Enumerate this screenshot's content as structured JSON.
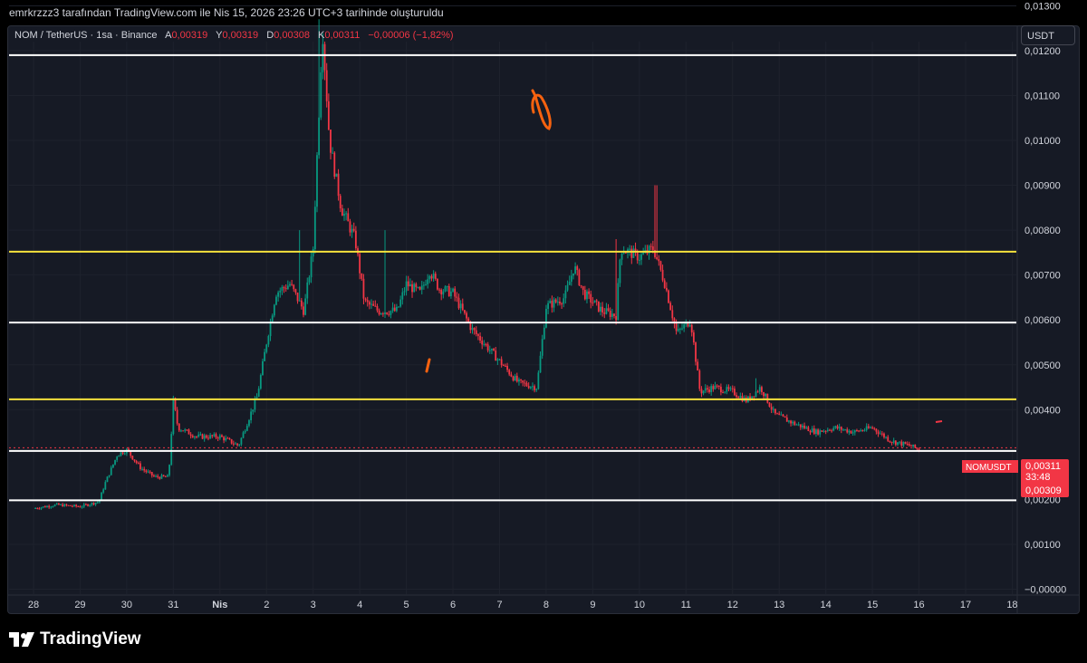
{
  "header": {
    "publish_line": "emrkrzzz3 tarafından TradingView.com ile Nis 15, 2026 23:26 UTC+3 tarihinde oluşturuldu"
  },
  "legend": {
    "symbol": "NOM / TetherUS · 1sa · Binance",
    "o_label": "A",
    "o_value": "0,00319",
    "h_label": "Y",
    "h_value": "0,00319",
    "l_label": "D",
    "l_value": "0,00308",
    "c_label": "K",
    "c_value": "0,00311",
    "change": "−0,00006 (−1,82%)"
  },
  "currency_button": "USDT",
  "price_tag": {
    "symbol": "NOMUSDT",
    "last": "0,00311",
    "countdown": "33:48",
    "bid": "0,00309"
  },
  "footer": {
    "brand": "TradingView"
  },
  "colors": {
    "up": "#089981",
    "down": "#f23645",
    "white_line": "#ffffff",
    "yellow_line": "#f5e23c",
    "annotation": "#f7620f",
    "background": "#161a25"
  },
  "chart_data": {
    "type": "candlestick",
    "ylim": [
      -0.0002,
      0.0145
    ],
    "y_ticks": [
      {
        "value": 0.013,
        "label": "0,01300"
      },
      {
        "value": 0.012,
        "label": "0,01200"
      },
      {
        "value": 0.011,
        "label": "0,01100"
      },
      {
        "value": 0.01,
        "label": "0,01000"
      },
      {
        "value": 0.009,
        "label": "0,00900"
      },
      {
        "value": 0.008,
        "label": "0,00800"
      },
      {
        "value": 0.007,
        "label": "0,00700"
      },
      {
        "value": 0.006,
        "label": "0,00600"
      },
      {
        "value": 0.005,
        "label": "0,00500"
      },
      {
        "value": 0.004,
        "label": "0,00400"
      },
      {
        "value": 0.002,
        "label": "0,00200"
      },
      {
        "value": 0.001,
        "label": "0,00100"
      },
      {
        "value": 0.0,
        "label": "−0,00000"
      }
    ],
    "x_labels": [
      "28",
      "29",
      "30",
      "31",
      "Nis",
      "2",
      "3",
      "4",
      "5",
      "6",
      "7",
      "8",
      "9",
      "10",
      "11",
      "12",
      "13",
      "14",
      "15",
      "16",
      "17",
      "18"
    ],
    "horizontal_levels": [
      {
        "value": 0.0119,
        "color": "white"
      },
      {
        "value": 0.00752,
        "color": "yellow"
      },
      {
        "value": 0.00594,
        "color": "white"
      },
      {
        "value": 0.00423,
        "color": "yellow"
      },
      {
        "value": 0.00308,
        "color": "white"
      },
      {
        "value": 0.00198,
        "color": "white"
      }
    ],
    "last_price": 0.00311,
    "price_path": [
      [
        0,
        0.0018
      ],
      [
        0.5,
        0.00188
      ],
      [
        1.0,
        0.00184
      ],
      [
        1.4,
        0.00195
      ],
      [
        1.55,
        0.0024
      ],
      [
        1.8,
        0.003
      ],
      [
        2.0,
        0.0031
      ],
      [
        2.3,
        0.0027
      ],
      [
        2.6,
        0.0025
      ],
      [
        2.9,
        0.0025
      ],
      [
        3.0,
        0.0042
      ],
      [
        3.1,
        0.0036
      ],
      [
        3.5,
        0.0034
      ],
      [
        4.0,
        0.0034
      ],
      [
        4.4,
        0.0032
      ],
      [
        4.8,
        0.0043
      ],
      [
        5.0,
        0.0055
      ],
      [
        5.2,
        0.0066
      ],
      [
        5.5,
        0.0068
      ],
      [
        5.8,
        0.0062
      ],
      [
        6.0,
        0.0076
      ],
      [
        6.2,
        0.0125
      ],
      [
        6.35,
        0.01
      ],
      [
        6.6,
        0.0085
      ],
      [
        6.9,
        0.0078
      ],
      [
        7.1,
        0.0064
      ],
      [
        7.4,
        0.0062
      ],
      [
        7.8,
        0.0062
      ],
      [
        8.0,
        0.0068
      ],
      [
        8.3,
        0.0066
      ],
      [
        8.5,
        0.0071
      ],
      [
        8.7,
        0.0067
      ],
      [
        9.0,
        0.0066
      ],
      [
        9.4,
        0.0058
      ],
      [
        9.9,
        0.0052
      ],
      [
        10.4,
        0.0046
      ],
      [
        10.8,
        0.0045
      ],
      [
        11.0,
        0.0063
      ],
      [
        11.4,
        0.0065
      ],
      [
        11.6,
        0.0072
      ],
      [
        11.8,
        0.0066
      ],
      [
        12.2,
        0.0062
      ],
      [
        12.5,
        0.0061
      ],
      [
        12.6,
        0.0076
      ],
      [
        13.0,
        0.0074
      ],
      [
        13.3,
        0.0076
      ],
      [
        13.55,
        0.0068
      ],
      [
        13.8,
        0.0057
      ],
      [
        14.1,
        0.006
      ],
      [
        14.3,
        0.0044
      ],
      [
        14.6,
        0.0045
      ],
      [
        15.0,
        0.0044
      ],
      [
        15.3,
        0.0042
      ],
      [
        15.6,
        0.0045
      ],
      [
        15.9,
        0.0039
      ],
      [
        16.3,
        0.0037
      ],
      [
        16.8,
        0.0035
      ],
      [
        17.2,
        0.0036
      ],
      [
        17.6,
        0.0035
      ],
      [
        18.0,
        0.0036
      ],
      [
        18.4,
        0.0033
      ],
      [
        18.8,
        0.0032
      ],
      [
        19.0,
        0.00311
      ]
    ],
    "spikes": [
      {
        "x": 6.12,
        "high": 0.0127
      },
      {
        "x": 6.3,
        "high": 0.0106
      },
      {
        "x": 5.7,
        "high": 0.008
      },
      {
        "x": 7.55,
        "high": 0.008
      },
      {
        "x": 12.5,
        "high": 0.0078
      },
      {
        "x": 13.35,
        "high": 0.009
      },
      {
        "x": 15.5,
        "high": 0.0047
      }
    ]
  }
}
